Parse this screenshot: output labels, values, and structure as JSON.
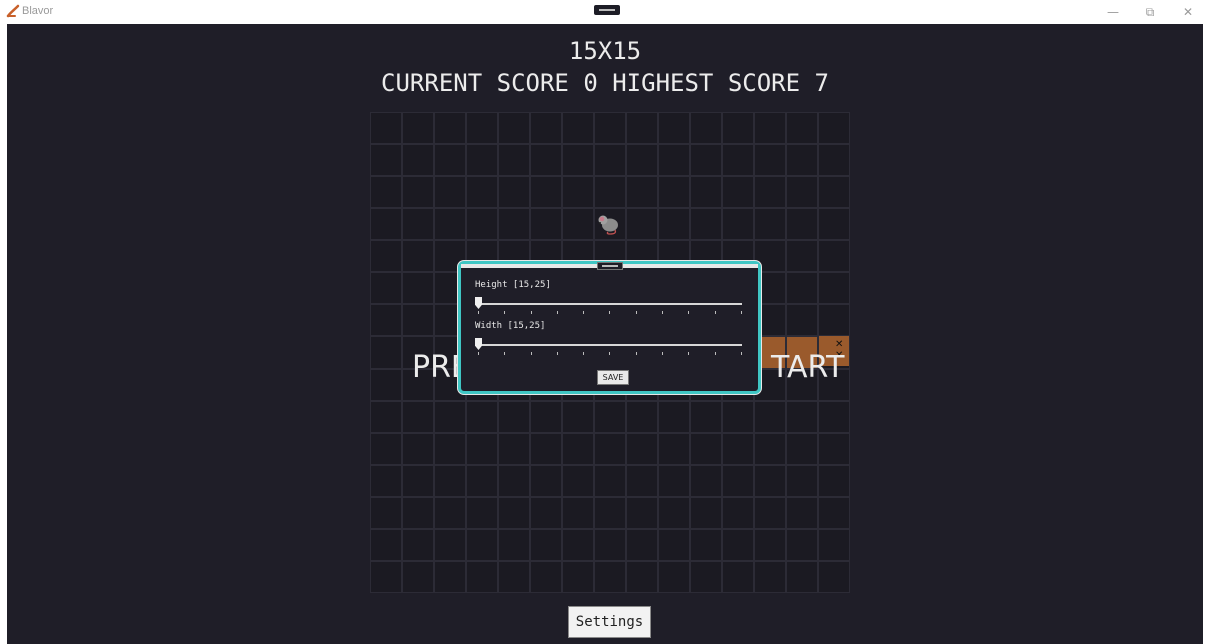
{
  "window": {
    "title": "Blavor",
    "minimize_glyph": "—",
    "restore_glyph": "⧉",
    "close_glyph": "✕"
  },
  "game": {
    "board_size": "15X15",
    "score_line": "CURRENT SCORE 0 HIGHEST SCORE 7",
    "overlay_left": "PRE",
    "overlay_right": "TART",
    "rows": 15,
    "cols": 15,
    "food_icon": "mouse-icon"
  },
  "settings_popup": {
    "height_label": "Height [15,25]",
    "height_value": 15,
    "width_label": "Width [15,25]",
    "width_value": 15,
    "save_label": "SAVE",
    "tick_count": 11
  },
  "footer": {
    "settings_label": "Settings"
  },
  "colors": {
    "background": "#1f1e28",
    "cell": "#1b1a22",
    "snake": "#9a5a2c",
    "popup_border": "#3fc6c4"
  }
}
